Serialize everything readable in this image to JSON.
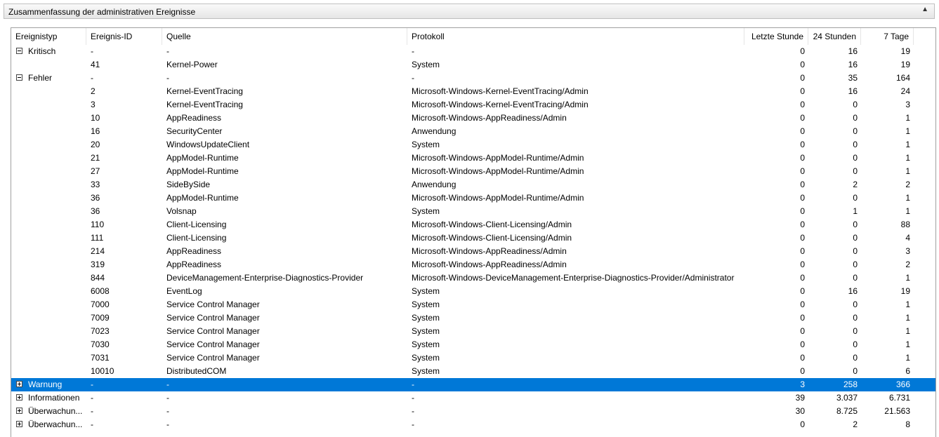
{
  "panel": {
    "title": "Zusammenfassung der administrativen Ereignisse",
    "collapse_glyph": "▲"
  },
  "columns": [
    "Ereignistyp",
    "Ereignis-ID",
    "Quelle",
    "Protokoll",
    "Letzte Stunde",
    "24 Stunden",
    "7 Tage"
  ],
  "rows": [
    {
      "type": "Kritisch",
      "id": "-",
      "source": "-",
      "log": "-",
      "hour": "0",
      "day": "16",
      "week": "19",
      "group": true,
      "expanded": true
    },
    {
      "type": "",
      "id": "41",
      "source": "Kernel-Power",
      "log": "System",
      "hour": "0",
      "day": "16",
      "week": "19"
    },
    {
      "type": "Fehler",
      "id": "-",
      "source": "-",
      "log": "-",
      "hour": "0",
      "day": "35",
      "week": "164",
      "group": true,
      "expanded": true
    },
    {
      "type": "",
      "id": "2",
      "source": "Kernel-EventTracing",
      "log": "Microsoft-Windows-Kernel-EventTracing/Admin",
      "hour": "0",
      "day": "16",
      "week": "24"
    },
    {
      "type": "",
      "id": "3",
      "source": "Kernel-EventTracing",
      "log": "Microsoft-Windows-Kernel-EventTracing/Admin",
      "hour": "0",
      "day": "0",
      "week": "3"
    },
    {
      "type": "",
      "id": "10",
      "source": "AppReadiness",
      "log": "Microsoft-Windows-AppReadiness/Admin",
      "hour": "0",
      "day": "0",
      "week": "1"
    },
    {
      "type": "",
      "id": "16",
      "source": "SecurityCenter",
      "log": "Anwendung",
      "hour": "0",
      "day": "0",
      "week": "1"
    },
    {
      "type": "",
      "id": "20",
      "source": "WindowsUpdateClient",
      "log": "System",
      "hour": "0",
      "day": "0",
      "week": "1"
    },
    {
      "type": "",
      "id": "21",
      "source": "AppModel-Runtime",
      "log": "Microsoft-Windows-AppModel-Runtime/Admin",
      "hour": "0",
      "day": "0",
      "week": "1"
    },
    {
      "type": "",
      "id": "27",
      "source": "AppModel-Runtime",
      "log": "Microsoft-Windows-AppModel-Runtime/Admin",
      "hour": "0",
      "day": "0",
      "week": "1"
    },
    {
      "type": "",
      "id": "33",
      "source": "SideBySide",
      "log": "Anwendung",
      "hour": "0",
      "day": "2",
      "week": "2"
    },
    {
      "type": "",
      "id": "36",
      "source": "AppModel-Runtime",
      "log": "Microsoft-Windows-AppModel-Runtime/Admin",
      "hour": "0",
      "day": "0",
      "week": "1"
    },
    {
      "type": "",
      "id": "36",
      "source": "Volsnap",
      "log": "System",
      "hour": "0",
      "day": "1",
      "week": "1"
    },
    {
      "type": "",
      "id": "110",
      "source": "Client-Licensing",
      "log": "Microsoft-Windows-Client-Licensing/Admin",
      "hour": "0",
      "day": "0",
      "week": "88"
    },
    {
      "type": "",
      "id": "111",
      "source": "Client-Licensing",
      "log": "Microsoft-Windows-Client-Licensing/Admin",
      "hour": "0",
      "day": "0",
      "week": "4"
    },
    {
      "type": "",
      "id": "214",
      "source": "AppReadiness",
      "log": "Microsoft-Windows-AppReadiness/Admin",
      "hour": "0",
      "day": "0",
      "week": "3"
    },
    {
      "type": "",
      "id": "319",
      "source": "AppReadiness",
      "log": "Microsoft-Windows-AppReadiness/Admin",
      "hour": "0",
      "day": "0",
      "week": "2"
    },
    {
      "type": "",
      "id": "844",
      "source": "DeviceManagement-Enterprise-Diagnostics-Provider",
      "log": "Microsoft-Windows-DeviceManagement-Enterprise-Diagnostics-Provider/Administrator",
      "hour": "0",
      "day": "0",
      "week": "1"
    },
    {
      "type": "",
      "id": "6008",
      "source": "EventLog",
      "log": "System",
      "hour": "0",
      "day": "16",
      "week": "19"
    },
    {
      "type": "",
      "id": "7000",
      "source": "Service Control Manager",
      "log": "System",
      "hour": "0",
      "day": "0",
      "week": "1"
    },
    {
      "type": "",
      "id": "7009",
      "source": "Service Control Manager",
      "log": "System",
      "hour": "0",
      "day": "0",
      "week": "1"
    },
    {
      "type": "",
      "id": "7023",
      "source": "Service Control Manager",
      "log": "System",
      "hour": "0",
      "day": "0",
      "week": "1"
    },
    {
      "type": "",
      "id": "7030",
      "source": "Service Control Manager",
      "log": "System",
      "hour": "0",
      "day": "0",
      "week": "1"
    },
    {
      "type": "",
      "id": "7031",
      "source": "Service Control Manager",
      "log": "System",
      "hour": "0",
      "day": "0",
      "week": "1"
    },
    {
      "type": "",
      "id": "10010",
      "source": "DistributedCOM",
      "log": "System",
      "hour": "0",
      "day": "0",
      "week": "6"
    },
    {
      "type": "Warnung",
      "id": "-",
      "source": "-",
      "log": "-",
      "hour": "3",
      "day": "258",
      "week": "366",
      "group": true,
      "expanded": false,
      "selected": true
    },
    {
      "type": "Informationen",
      "id": "-",
      "source": "-",
      "log": "-",
      "hour": "39",
      "day": "3.037",
      "week": "6.731",
      "group": true,
      "expanded": false
    },
    {
      "type": "Überwachun...",
      "id": "-",
      "source": "-",
      "log": "-",
      "hour": "30",
      "day": "8.725",
      "week": "21.563",
      "group": true,
      "expanded": false
    },
    {
      "type": "Überwachun...",
      "id": "-",
      "source": "-",
      "log": "-",
      "hour": "0",
      "day": "2",
      "week": "8",
      "group": true,
      "expanded": false
    }
  ]
}
